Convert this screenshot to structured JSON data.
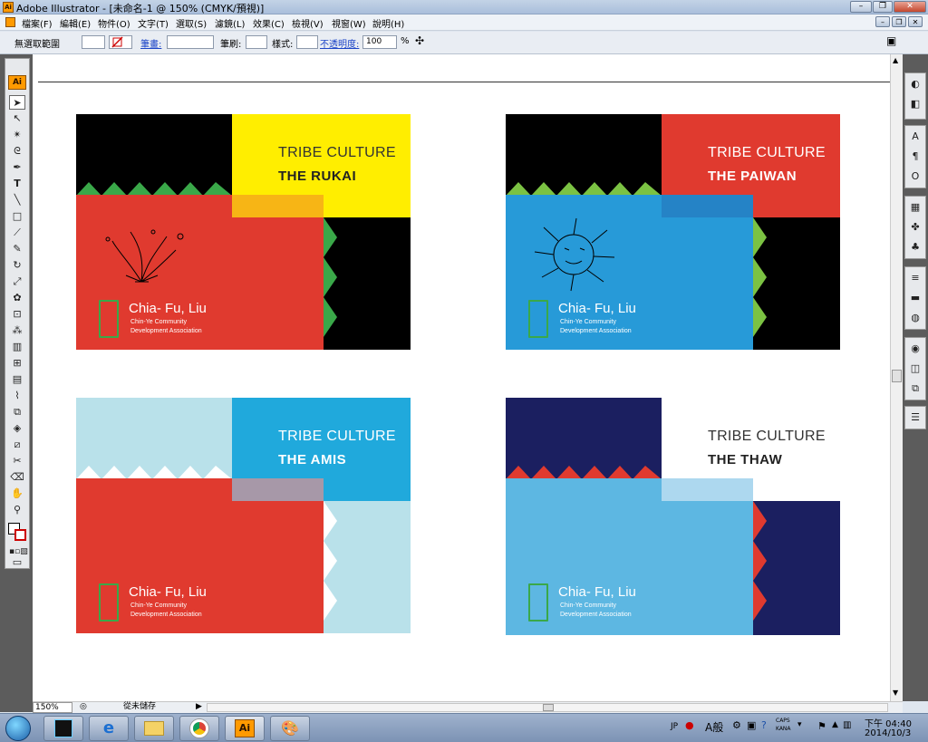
{
  "window": {
    "title": "Adobe Illustrator - [未命名-1 @ 150% (CMYK/預視)]",
    "buttons": [
      "–",
      "❐",
      "✕"
    ]
  },
  "menubar": {
    "items": [
      "檔案(F)",
      "編輯(E)",
      "物件(O)",
      "文字(T)",
      "選取(S)",
      "濾鏡(L)",
      "效果(C)",
      "檢視(V)",
      "視窗(W)",
      "說明(H)"
    ]
  },
  "controlbar": {
    "selection_label": "無選取範圍",
    "stroke_label": "筆畫:",
    "brush_label": "筆刷:",
    "style_label": "樣式:",
    "opacity_label": "不透明度:",
    "opacity_value": "100",
    "opacity_unit": "%"
  },
  "statusbar": {
    "zoom": "150%",
    "status": "從未儲存"
  },
  "cards": [
    {
      "line1": "TRIBE CULTURE",
      "line2": "THE RUKAI",
      "name": "Chia- Fu, Liu",
      "org1": "Chin-Ye Community",
      "org2": "Development Association"
    },
    {
      "line1": "TRIBE CULTURE",
      "line2": "THE PAIWAN",
      "name": "Chia- Fu, Liu",
      "org1": "Chin-Ye Community",
      "org2": "Development Association"
    },
    {
      "line1": "TRIBE CULTURE",
      "line2": "THE AMIS",
      "name": "Chia- Fu, Liu",
      "org1": "Chin-Ye Community",
      "org2": "Development Association"
    },
    {
      "line1": "TRIBE CULTURE",
      "line2": "THE THAW",
      "name": "Chia- Fu, Liu",
      "org1": "Chin-Ye Community",
      "org2": "Development Association"
    }
  ],
  "toolbox": {
    "badge": "Ai"
  },
  "taskbar": {
    "ai_label": "Ai",
    "tray_lang": "JP",
    "tray_ime": "A般",
    "tray_caps": "CAPS",
    "tray_kana": "KANA",
    "time": "下午 04:40",
    "date": "2014/10/3"
  },
  "colors": {
    "red": "#e03a2f",
    "yellow": "#ffee00",
    "blue": "#279ad8",
    "cyan": "#20a9dc",
    "lightblue": "#b9e1ea",
    "navy": "#1b1f60",
    "skyblue": "#5db7e2",
    "green": "#3aa849"
  }
}
